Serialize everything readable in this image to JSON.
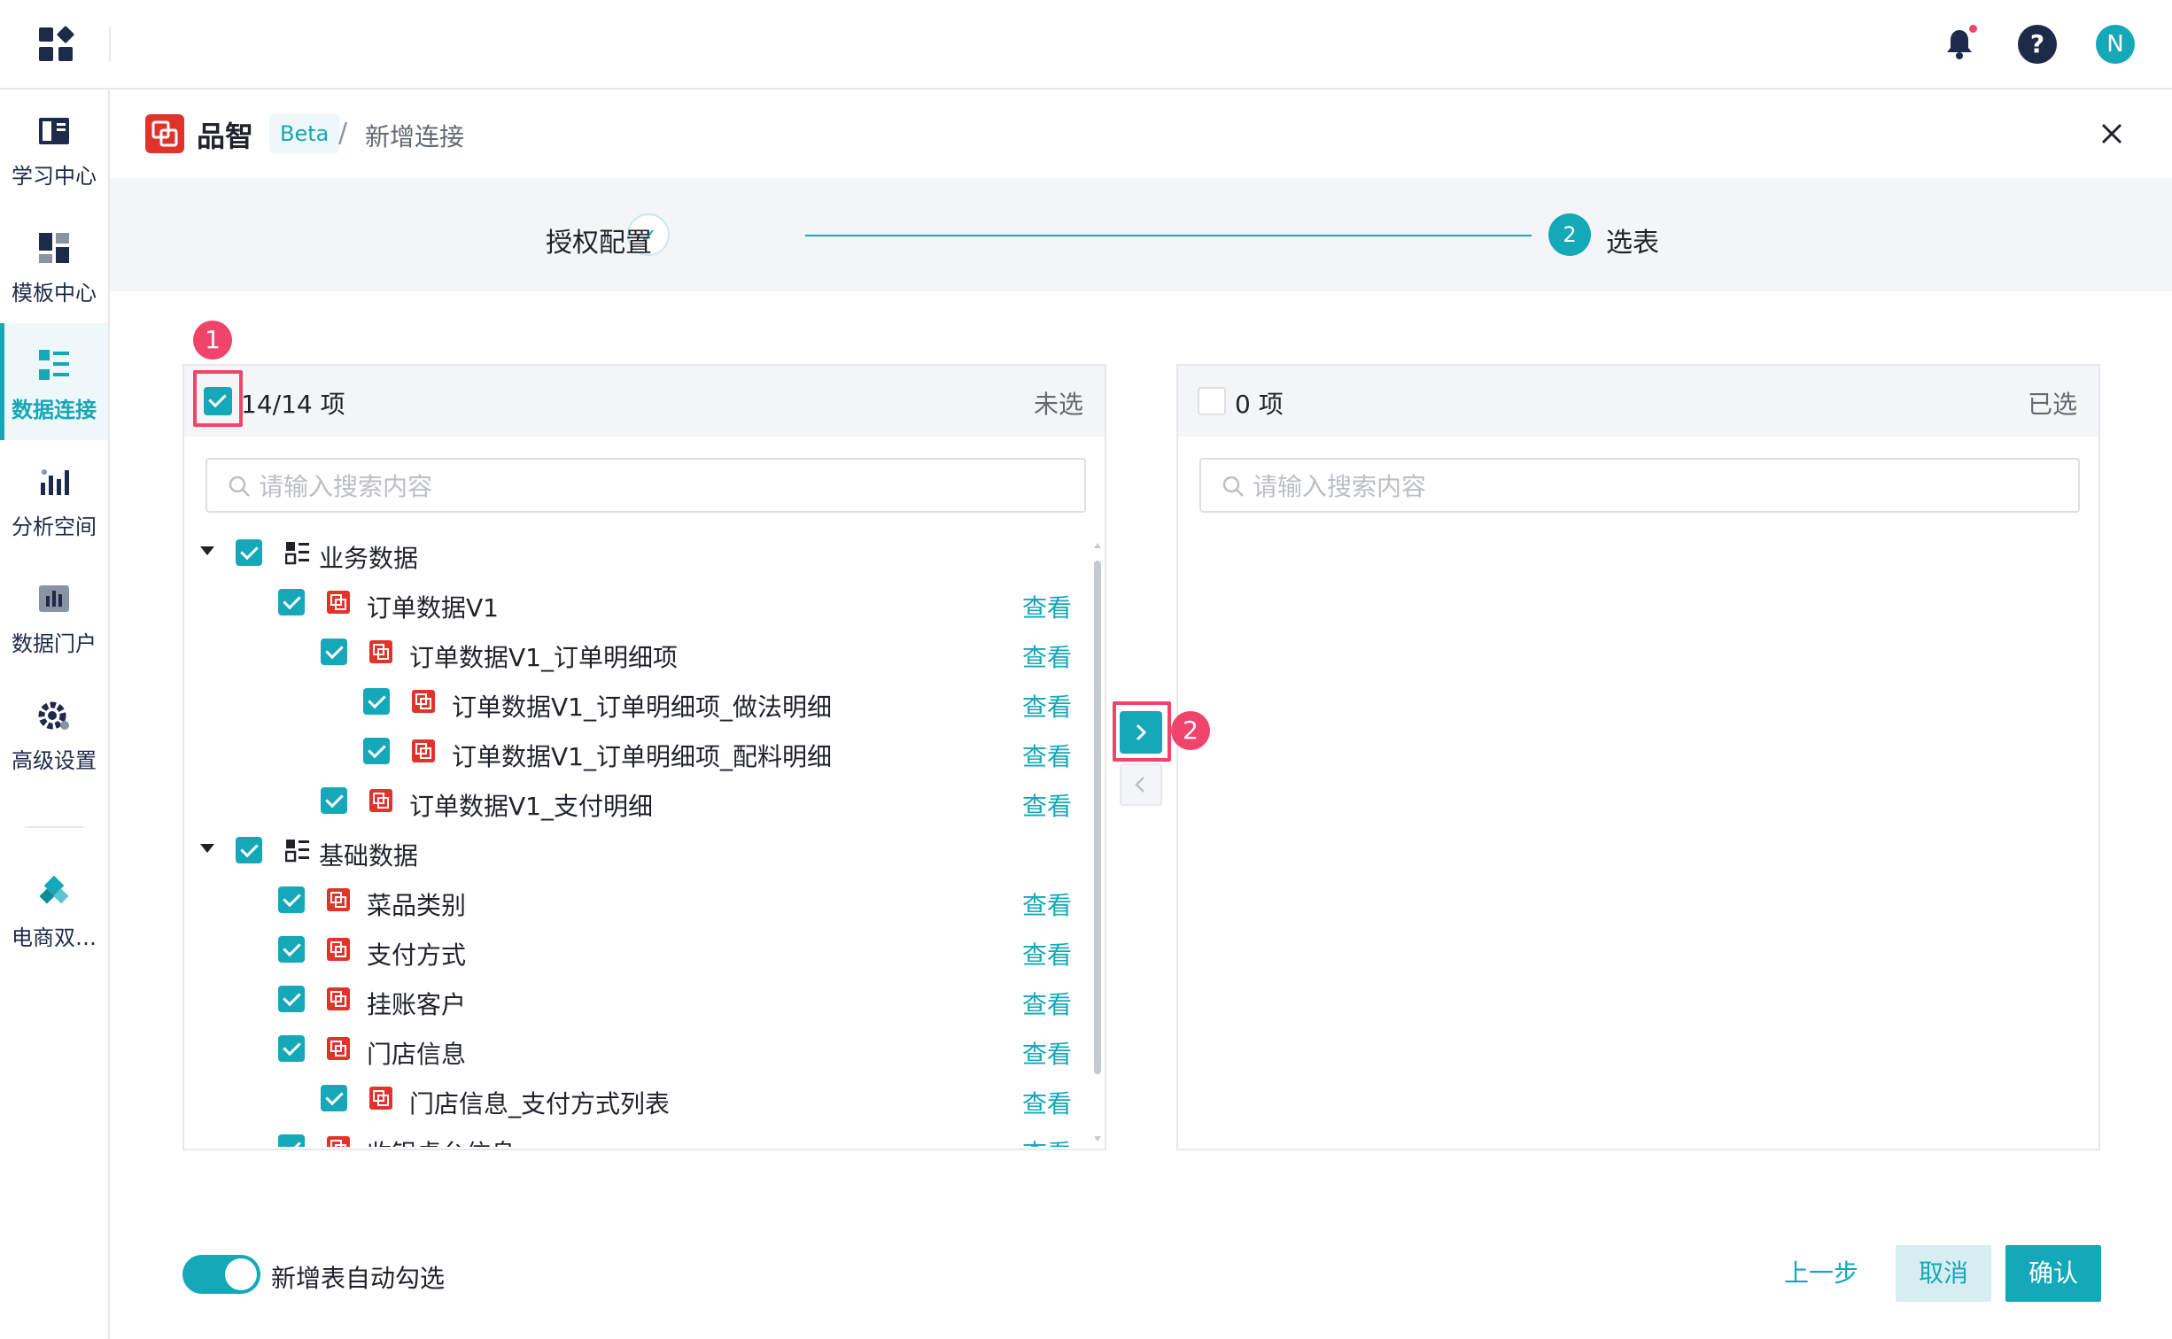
{
  "topbar": {
    "app_switcher_icon": "grid-icon",
    "notification_icon": "bell-icon",
    "help_icon": "help-icon",
    "help_glyph": "?",
    "avatar_letter": "N"
  },
  "sidebar": {
    "items": [
      {
        "label": "学习中心",
        "icon": "book-icon"
      },
      {
        "label": "模板中心",
        "icon": "template-icon"
      },
      {
        "label": "数据连接",
        "icon": "data-connection-icon",
        "active": true
      },
      {
        "label": "分析空间",
        "icon": "analysis-icon"
      },
      {
        "label": "数据门户",
        "icon": "portal-icon"
      },
      {
        "label": "高级设置",
        "icon": "settings-gear-icon"
      },
      {
        "label": "电商双…",
        "icon": "diamond-icon"
      }
    ]
  },
  "header": {
    "product_name": "品智",
    "badge": "Beta",
    "separator": "/",
    "page": "新增连接"
  },
  "steps": [
    {
      "label": "授权配置",
      "state": "done",
      "mark": "✓"
    },
    {
      "label": "选表",
      "state": "active",
      "number": "2"
    }
  ],
  "left_panel": {
    "count": "14/14 项",
    "title": "未选",
    "search_placeholder": "请输入搜索内容",
    "rows": [
      {
        "label": "业务数据",
        "type": "group",
        "view": ""
      },
      {
        "label": "订单数据V1",
        "type": "table",
        "view": "查看"
      },
      {
        "label": "订单数据V1_订单明细项",
        "type": "table",
        "view": "查看"
      },
      {
        "label": "订单数据V1_订单明细项_做法明细",
        "type": "table",
        "view": "查看"
      },
      {
        "label": "订单数据V1_订单明细项_配料明细",
        "type": "table",
        "view": "查看"
      },
      {
        "label": "订单数据V1_支付明细",
        "type": "table",
        "view": "查看"
      },
      {
        "label": "基础数据",
        "type": "group",
        "view": ""
      },
      {
        "label": "菜品类别",
        "type": "table",
        "view": "查看"
      },
      {
        "label": "支付方式",
        "type": "table",
        "view": "查看"
      },
      {
        "label": "挂账客户",
        "type": "table",
        "view": "查看"
      },
      {
        "label": "门店信息",
        "type": "table",
        "view": "查看"
      },
      {
        "label": "门店信息_支付方式列表",
        "type": "table",
        "view": "查看"
      },
      {
        "label": "收银桌台信息",
        "type": "table",
        "view": "查看"
      }
    ]
  },
  "right_panel": {
    "count": "0 项",
    "title": "已选",
    "search_placeholder": "请输入搜索内容"
  },
  "transfer": {
    "move_right": "chevron-right-icon",
    "move_left": "chevron-left-icon"
  },
  "annotations": {
    "badge_1": "1",
    "badge_2": "2",
    "color": "#f0446a"
  },
  "footer": {
    "auto_select_label": "新增表自动勾选",
    "auto_select_on": true,
    "prev_label": "上一步",
    "cancel_label": "取消",
    "confirm_label": "确认"
  },
  "colors": {
    "accent": "#14a8b8",
    "brand_red": "#e0342b",
    "nav_dark": "#1e2a4a",
    "annotation": "#f0446a"
  }
}
